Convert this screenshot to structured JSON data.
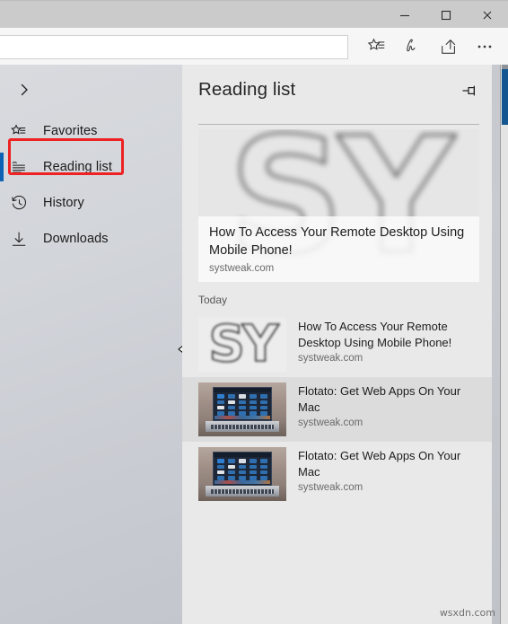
{
  "window": {
    "minimize_label": "Minimize",
    "maximize_label": "Maximize",
    "close_label": "Close"
  },
  "toolbar": {
    "address_value": "",
    "address_placeholder": "",
    "buttons": [
      {
        "name": "favorites-icon",
        "label": "Favorites"
      },
      {
        "name": "web-note-icon",
        "label": "Make a Web Note"
      },
      {
        "name": "share-icon",
        "label": "Share"
      },
      {
        "name": "more-icon",
        "label": "Settings and more"
      }
    ]
  },
  "sidebar": {
    "expand_label": "Expand",
    "items": [
      {
        "label": "Favorites",
        "icon": "favorites-icon",
        "selected": false
      },
      {
        "label": "Reading list",
        "icon": "reading-list-icon",
        "selected": true
      },
      {
        "label": "History",
        "icon": "history-icon",
        "selected": false
      },
      {
        "label": "Downloads",
        "icon": "downloads-icon",
        "selected": false
      }
    ],
    "annotation_color": "#ee2222",
    "selection_color": "#0c62b5"
  },
  "panel": {
    "title": "Reading list",
    "pin_label": "Pin this pane",
    "featured": {
      "title": "How To Access Your Remote Desktop Using Mobile Phone!",
      "domain": "systweak.com",
      "image_text": "SY"
    },
    "groups": [
      {
        "label": "Today",
        "items": [
          {
            "title": "How To Access Your Remote Desktop Using Mobile Phone!",
            "domain": "systweak.com",
            "thumb": "sy-logo",
            "hovered": false
          },
          {
            "title": "Flotato: Get Web Apps On Your Mac",
            "domain": "systweak.com",
            "thumb": "laptop-photo",
            "hovered": true
          },
          {
            "title": "Flotato: Get Web Apps On Your Mac",
            "domain": "systweak.com",
            "thumb": "laptop-photo",
            "hovered": false
          }
        ]
      }
    ]
  },
  "watermark": "wsxdn.com"
}
